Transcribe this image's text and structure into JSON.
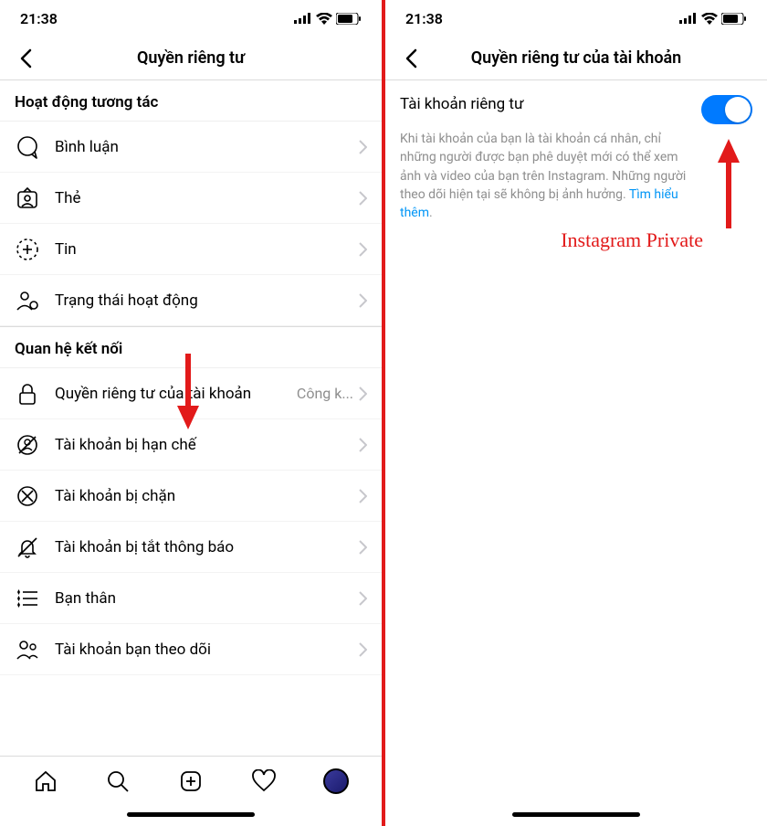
{
  "status": {
    "time": "21:38"
  },
  "left": {
    "title": "Quyền riêng tư",
    "section1": "Hoạt động tương tác",
    "rows1": {
      "comment": "Bình luận",
      "tag": "Thẻ",
      "story": "Tin",
      "activity": "Trạng thái hoạt động"
    },
    "section2": "Quan hệ kết nối",
    "rows2": {
      "privacy": "Quyền riêng tư của tài khoản",
      "privacy_value": "Công k...",
      "restricted": "Tài khoản bị hạn chế",
      "blocked": "Tài khoản bị chặn",
      "muted": "Tài khoản bị tắt thông báo",
      "close_friends": "Bạn thân",
      "following": "Tài khoản bạn theo dõi"
    }
  },
  "right": {
    "title": "Quyền riêng tư của tài khoản",
    "toggle_label": "Tài khoản riêng tư",
    "description": "Khi tài khoản của bạn là tài khoản cá nhân, chỉ những người được bạn phê duyệt mới có thể xem ảnh và video của bạn trên Instagram. Những người theo dõi hiện tại sẽ không bị ảnh hưởng.",
    "learn_more": "Tìm hiểu thêm",
    "toggle_on": true
  },
  "annotation": {
    "label": "Instagram Private"
  }
}
